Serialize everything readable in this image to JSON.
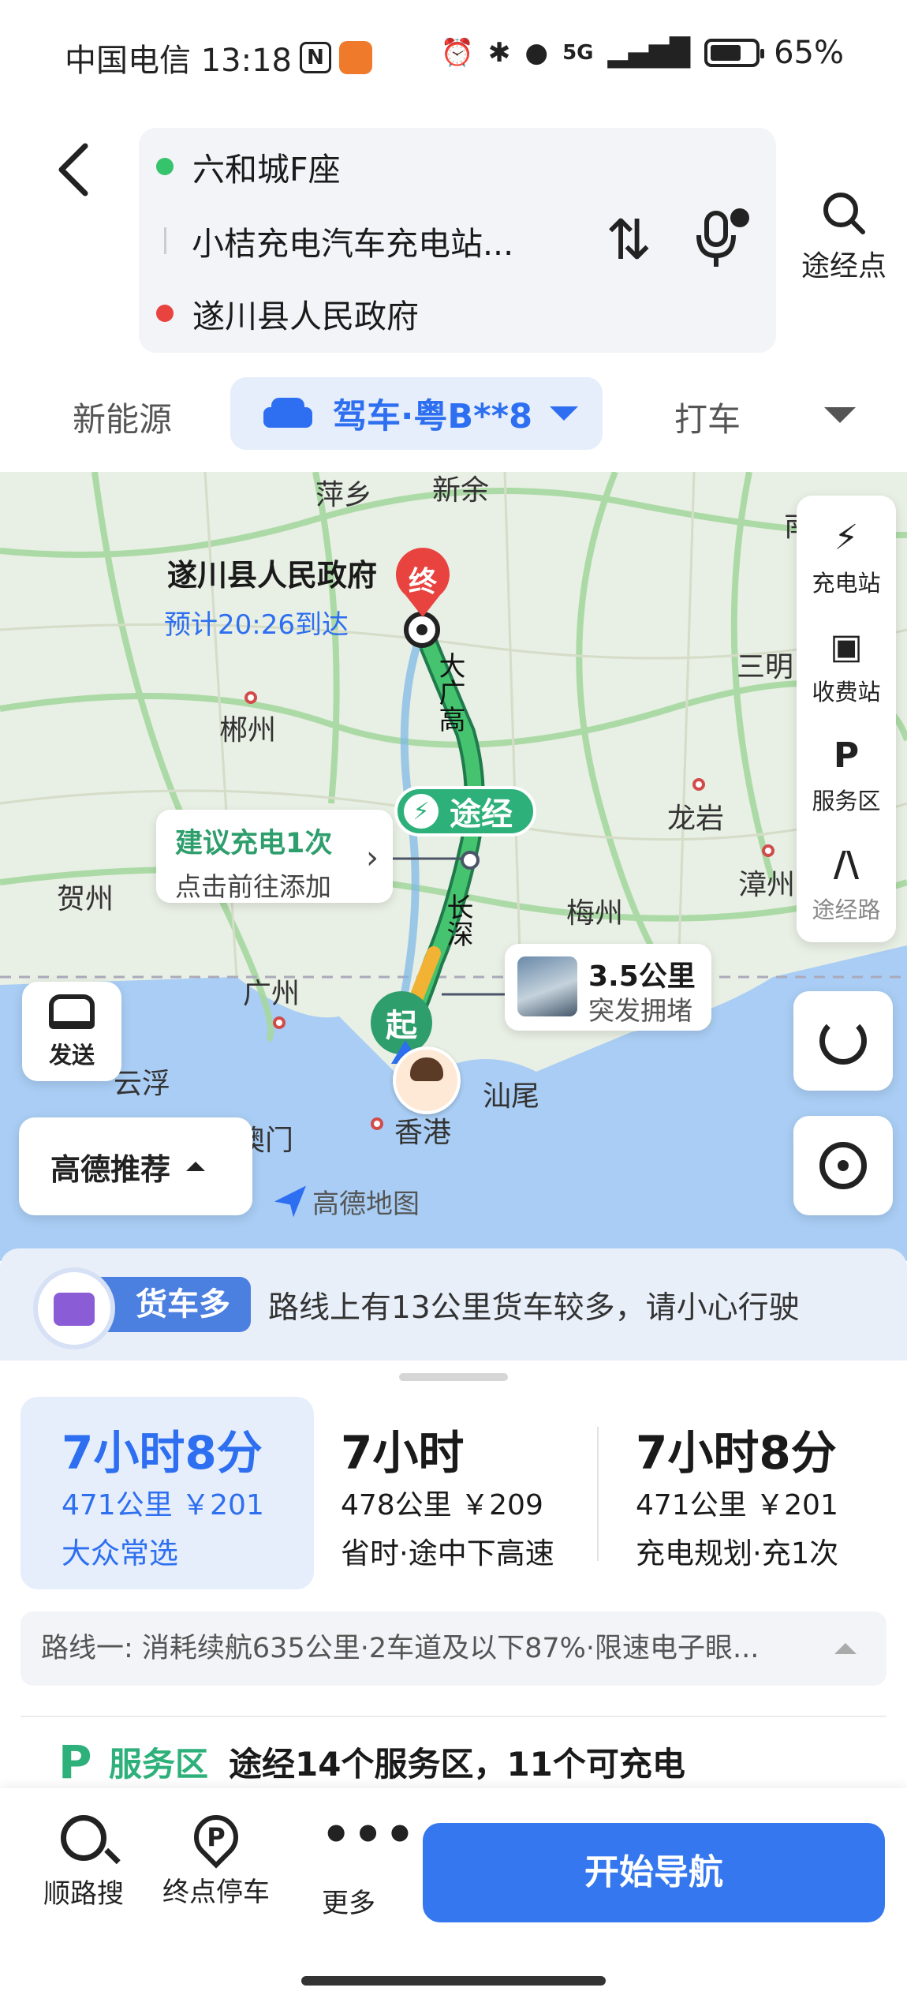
{
  "status_bar": {
    "carrier_time": "中国电信 13:18",
    "nfc": "N",
    "network": "5G",
    "battery": "65%",
    "icons": [
      "alarm-icon",
      "bluetooth-icon",
      "location-icon",
      "signal-icon",
      "battery-icon"
    ]
  },
  "route": {
    "origin": "六和城F座",
    "waypoint": "小桔充电汽车充电站...",
    "destination": "遂川县人民政府",
    "waypoints_button": "途经点"
  },
  "modes": {
    "new_energy": "新能源",
    "drive": "驾车·粤B**8",
    "taxi": "打车"
  },
  "map": {
    "labels": [
      "萍乡",
      "新余",
      "郴州",
      "三明",
      "龙岩",
      "贺州",
      "梅州",
      "漳州",
      "广州",
      "云浮",
      "汕尾",
      "澳门",
      "香港",
      "南"
    ],
    "road_labels": [
      "大广高",
      "长深"
    ],
    "destination_name": "遂川县人民政府",
    "destination_eta": "预计20:26到达",
    "end_pin": "终",
    "start_pin": "起",
    "waypoint_chip": "途经",
    "charge_tip_title": "建议充电1次",
    "charge_tip_sub": "点击前往添加",
    "jam_distance": "3.5公里",
    "jam_text": "突发拥堵",
    "sidebar": [
      "充电站",
      "收费站",
      "服务区",
      "途经路"
    ],
    "send": "发送",
    "recommend": "高德推荐",
    "logo": "高德地图"
  },
  "truck_notice": {
    "badge": "货车多",
    "message": "路线上有13公里货车较多，请小心行驶"
  },
  "routes": [
    {
      "time": "7小时8分",
      "dist": "471公里 ￥201",
      "tag": "大众常选"
    },
    {
      "time": "7小时",
      "dist": "478公里 ￥209",
      "tag": "省时·途中下高速"
    },
    {
      "time": "7小时8分",
      "dist": "471公里 ￥201",
      "tag": "充电规划·充1次"
    }
  ],
  "route_detail": "路线一: 消耗续航635公里·2车道及以下87%·限速电子眼...",
  "service": {
    "label": "服务区",
    "text": "途经14个服务区，11个可充电"
  },
  "bottom_bar": {
    "search": "顺路搜",
    "parking": "终点停车",
    "more": "更多",
    "start": "开始导航"
  },
  "colors": {
    "accent": "#3477ef",
    "green": "#2eb07a",
    "destination_red": "#e8433f"
  }
}
